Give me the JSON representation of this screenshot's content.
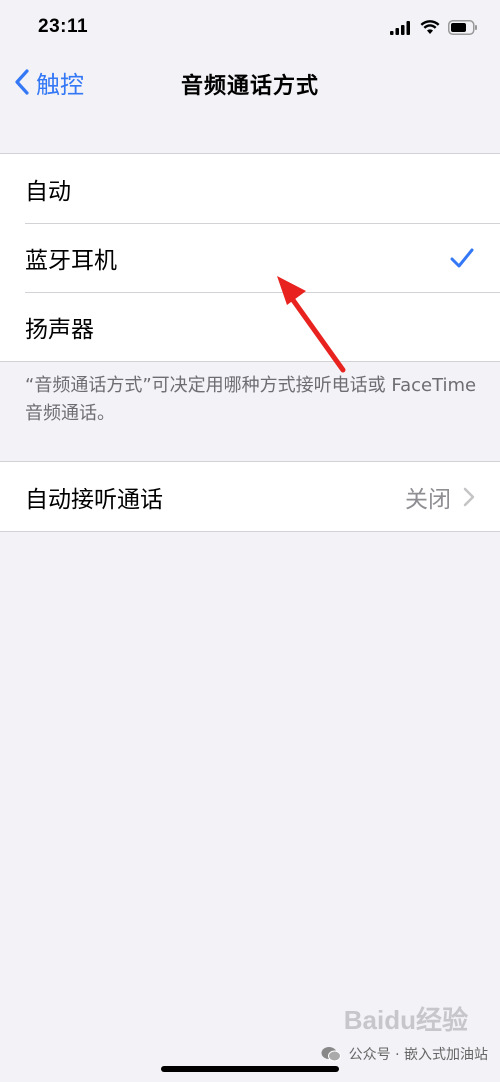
{
  "status_bar": {
    "time": "23:11"
  },
  "nav": {
    "back_label": "触控",
    "title": "音频通话方式"
  },
  "options": [
    {
      "label": "自动",
      "selected": false
    },
    {
      "label": "蓝牙耳机",
      "selected": true
    },
    {
      "label": "扬声器",
      "selected": false
    }
  ],
  "footer_note": "“音频通话方式”可决定用哪种方式接听电话或 FaceTime 音频通话。",
  "auto_answer": {
    "label": "自动接听通话",
    "value": "关闭"
  },
  "watermark": {
    "text": "公众号 · 嵌入式加油站",
    "brand": "Baidu经验"
  },
  "colors": {
    "accent": "#3478f6",
    "background": "#f2f2f7",
    "annotation_arrow": "#e8231f"
  },
  "icons": [
    "cellular-signal-icon",
    "wifi-icon",
    "battery-icon",
    "chevron-left-icon",
    "checkmark-icon",
    "chevron-right-icon",
    "wechat-icon"
  ]
}
